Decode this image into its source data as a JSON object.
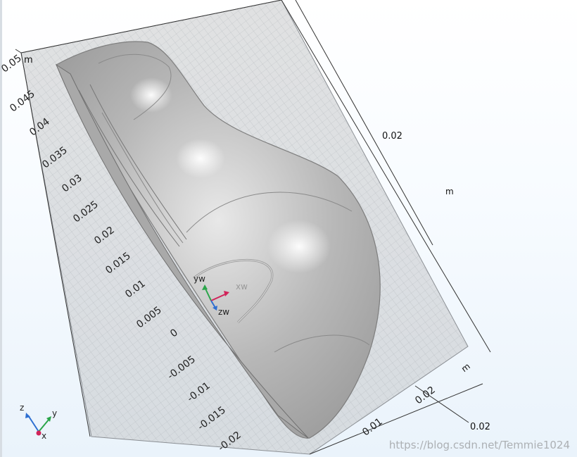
{
  "left_axis": {
    "ticks": [
      "0.05",
      "0.045",
      "0.04",
      "0.035",
      "0.03",
      "0.025",
      "0.02",
      "0.015",
      "0.01",
      "0.005",
      "0",
      "-0.005",
      "-0.01",
      "-0.015",
      "-0.02"
    ],
    "unit": "m"
  },
  "right_axis": {
    "tick": "0.02",
    "unit": "m"
  },
  "bottom_axis": {
    "ticks": [
      "0.01",
      "0.02"
    ],
    "unit": "m",
    "end_label": "0.02"
  },
  "work_plane_labels": {
    "y": "yw",
    "z": "zw",
    "x": "xw"
  },
  "triad": {
    "z": "z",
    "y": "y",
    "x": "x"
  },
  "colors": {
    "grid_plane": "#b9bcbf",
    "body_fill": "#b4b4b4",
    "axis_z": "#2aa54a",
    "axis_y": "#2aa54a",
    "axis_x": "#d1245a",
    "axis_blue": "#2e6fd1"
  },
  "watermark": "https://blog.csdn.net/Temmie1024"
}
